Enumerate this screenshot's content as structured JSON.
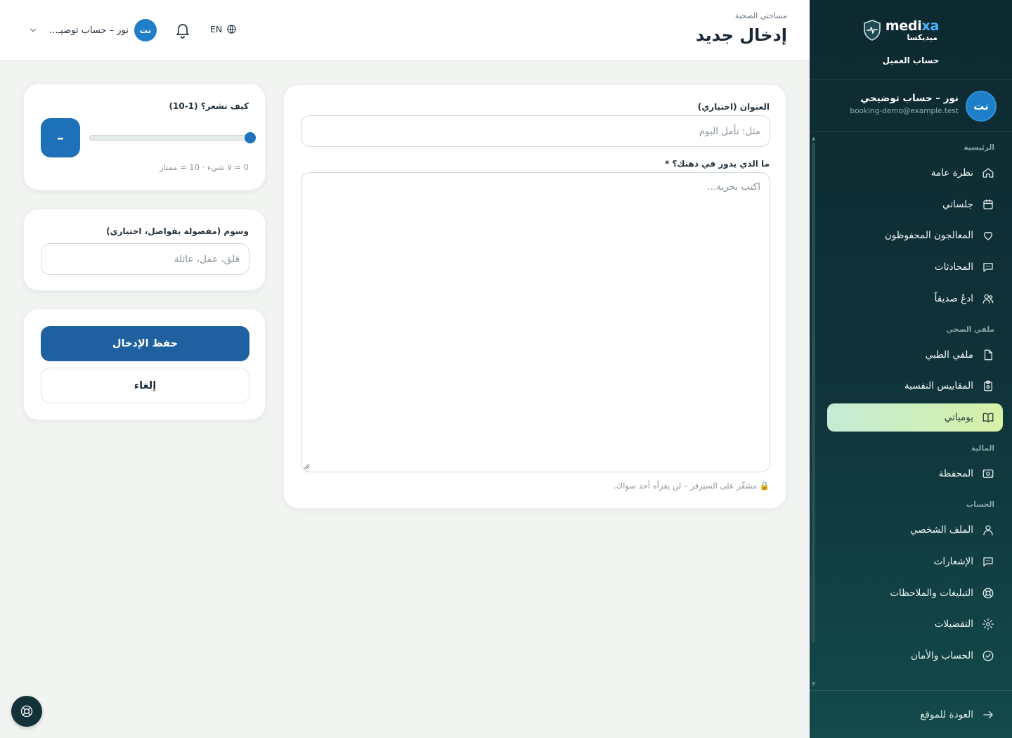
{
  "brand": {
    "name_prefix": "medi",
    "name_accent": "xa",
    "name_arabic": "ميديكسا",
    "account_type": "حساب العميل"
  },
  "user": {
    "initials": "نت",
    "name": "نور – حساب توضيحي",
    "email": "booking-demo@example.test",
    "header_name": "نور – حساب توضيـ..."
  },
  "nav": {
    "sections": [
      {
        "title": "الرئيسية",
        "items": [
          {
            "label": "نظرة عامة",
            "icon": "home-icon"
          },
          {
            "label": "جلساتي",
            "icon": "calendar-icon"
          },
          {
            "label": "المعالجون المحفوظون",
            "icon": "heart-icon"
          },
          {
            "label": "المحادثات",
            "icon": "chat-icon"
          },
          {
            "label": "ادعُ صديقاً",
            "icon": "users-icon"
          }
        ]
      },
      {
        "title": "ملفي الصحي",
        "items": [
          {
            "label": "ملفي الطبي",
            "icon": "file-icon"
          },
          {
            "label": "المقاييس النفسية",
            "icon": "clipboard-icon"
          },
          {
            "label": "يومياتي",
            "icon": "book-icon",
            "active": true
          }
        ]
      },
      {
        "title": "المالية",
        "items": [
          {
            "label": "المحفظة",
            "icon": "wallet-icon"
          }
        ]
      },
      {
        "title": "الحساب",
        "items": [
          {
            "label": "الملف الشخصي",
            "icon": "person-icon"
          },
          {
            "label": "الإشعارات",
            "icon": "chat-icon"
          },
          {
            "label": "التبليغات والملاحظات",
            "icon": "lifebuoy-icon"
          },
          {
            "label": "التفضيلات",
            "icon": "gear-icon"
          },
          {
            "label": "الحساب والأمان",
            "icon": "check-circle-icon"
          }
        ]
      }
    ],
    "back_to_site": "العودة للموقع"
  },
  "header": {
    "breadcrumb": "مساحتي الصحية",
    "title": "إدخال جديد",
    "language": "EN"
  },
  "entry_form": {
    "title_label": "العنوان (اختياري)",
    "title_placeholder": "مثل: تأمل اليوم",
    "body_label": "ما الذي يدور في ذهنك؟ *",
    "body_placeholder": "اكتب بحرية...",
    "privacy_hint": "🔒 مشفّر على السيرفر – لن يقرأه أحد سواك."
  },
  "mood": {
    "label": "كيف تشعر؟ (1-10)",
    "display_value": "–",
    "slider_level": 10,
    "slider_min": 1,
    "slider_max": 10,
    "range_hint": "0 = لا شيء · 10 = ممتاز"
  },
  "tags": {
    "label": "وسوم (مفصولة بفواصل، اختياري)",
    "placeholder": "قلق، عمل، عائلة"
  },
  "actions": {
    "save": "حفظ الإدخال",
    "cancel": "إلغاء"
  },
  "colors": {
    "primary": "#1e60a0",
    "accent": "#4cb4ff",
    "sidebar_bg": "#0f3239",
    "active_item": "#d6f0a6"
  }
}
